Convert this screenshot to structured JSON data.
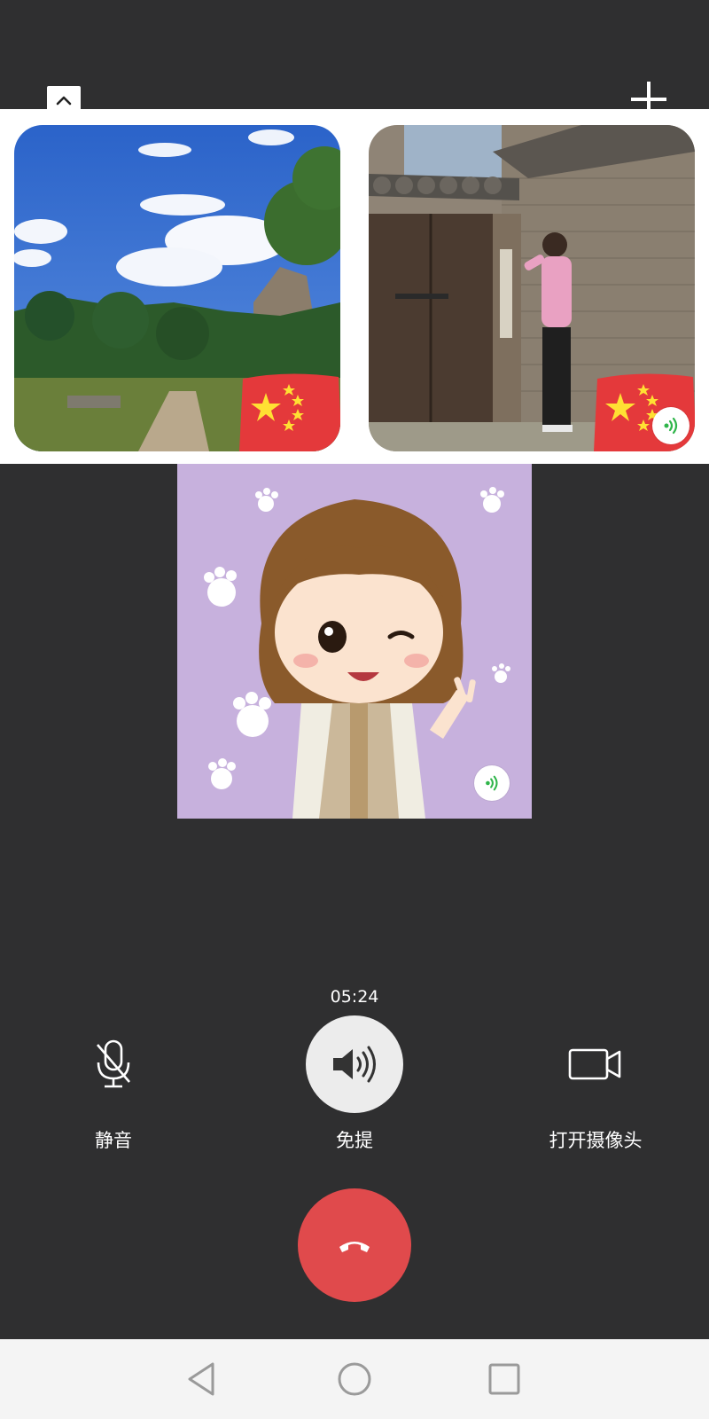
{
  "call": {
    "timer": "05:24"
  },
  "controls": {
    "mute_label": "静音",
    "speaker_label": "免提",
    "camera_label": "打开摄像头"
  },
  "icons": {
    "collapse": "chevron-up-icon",
    "add": "plus-icon",
    "mute": "microphone-off-icon",
    "speaker": "speaker-icon",
    "camera": "video-camera-icon",
    "hangup": "phone-hangup-icon",
    "nav_back": "triangle-back-icon",
    "nav_home": "circle-home-icon",
    "nav_recents": "square-recents-icon"
  },
  "colors": {
    "background": "#2f2f30",
    "hangup": "#e04a4c",
    "speaking": "#2fb54a"
  }
}
